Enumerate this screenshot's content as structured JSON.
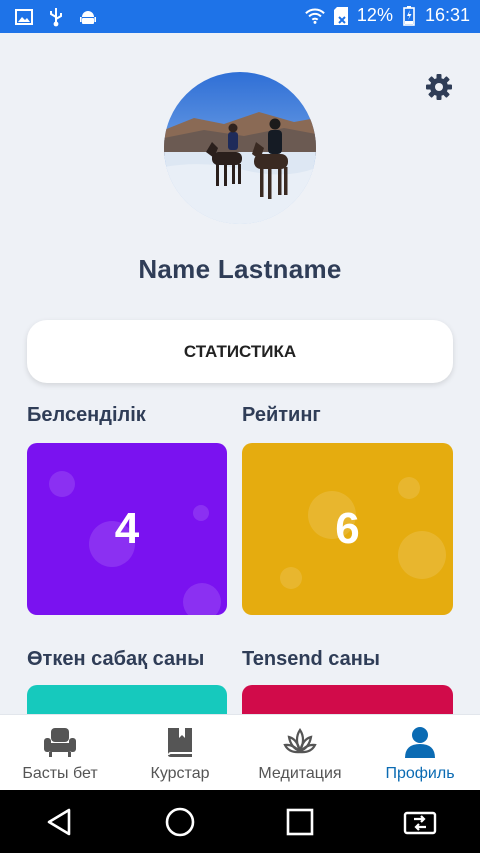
{
  "status_bar": {
    "battery": "12%",
    "time": "16:31"
  },
  "profile": {
    "name": "Name Lastname"
  },
  "stats_button": "СТАТИСТИКА",
  "sections": {
    "activity": {
      "label": "Белсенділік",
      "value": "4",
      "color": "#7a12f0"
    },
    "rating": {
      "label": "Рейтинг",
      "value": "6",
      "color": "#e5ac0f"
    },
    "lessons": {
      "label": "Өткен сабақ саны",
      "color": "#16c9bd"
    },
    "tensend": {
      "label": "Tensend саны",
      "color": "#d10b4a"
    }
  },
  "bottom_nav": [
    {
      "label": "Басты бет",
      "icon": "armchair-icon"
    },
    {
      "label": "Курстар",
      "icon": "book-icon"
    },
    {
      "label": "Медитация",
      "icon": "lotus-icon"
    },
    {
      "label": "Профиль",
      "icon": "person-icon",
      "active": true
    }
  ],
  "colors": {
    "status_bar": "#1e73e8",
    "active_nav": "#0b6bb3",
    "text_dark": "#2f3d57"
  }
}
